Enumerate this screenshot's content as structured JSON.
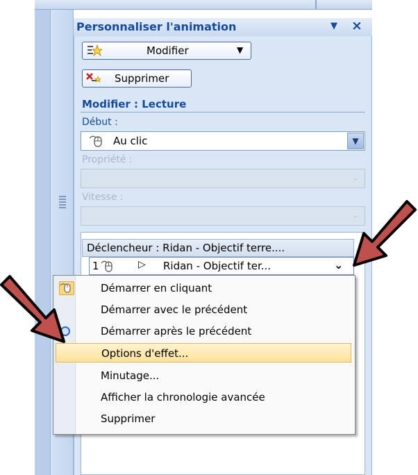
{
  "pane": {
    "title": "Personnaliser l'animation",
    "menu_glyph": "▼",
    "close_glyph": "×"
  },
  "toolbar": {
    "modify_label": "Modifier",
    "modify_caret": "▼",
    "delete_label": "Supprimer"
  },
  "section": {
    "title": "Modifier : Lecture"
  },
  "fields": {
    "start_label": "Début :",
    "start_value": "Au clic",
    "property_label": "Propriété :",
    "speed_label": "Vitesse :"
  },
  "list": {
    "trigger_label": "Déclencheur : Ridan - Objectif terre....",
    "effect_number": "1",
    "effect_name": "Ridan - Objectif ter...",
    "effect_play": "▷",
    "effect_chevron": "⌄"
  },
  "context_menu": {
    "items": [
      {
        "label": "Démarrer en cliquant"
      },
      {
        "label": "Démarrer avec le précédent"
      },
      {
        "label": "Démarrer après le précédent"
      },
      {
        "label": "Options d'effet..."
      },
      {
        "label": "Minutage..."
      },
      {
        "label": "Afficher la chronologie avancée"
      },
      {
        "label": "Supprimer"
      }
    ],
    "highlighted_index": 3
  },
  "colors": {
    "accent_blue": "#154a9a",
    "arrow_red": "#c0504d",
    "highlight": "#ffe19b"
  }
}
